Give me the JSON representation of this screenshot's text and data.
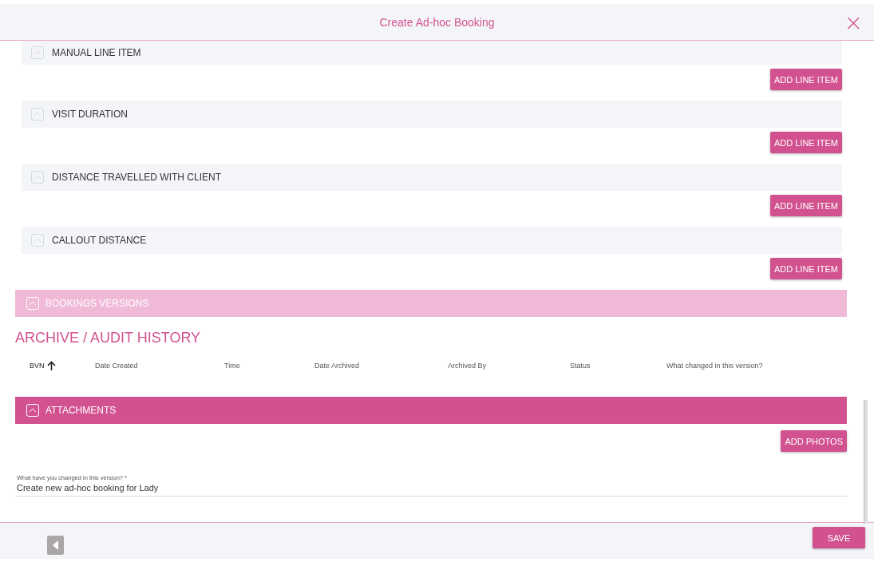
{
  "window": {
    "title": "Create Ad-hoc Booking",
    "close_icon": "×"
  },
  "line_items": [
    {
      "label": "MANUAL LINE ITEM",
      "button": "ADD LINE ITEM"
    },
    {
      "label": "VISIT DURATION",
      "button": "ADD LINE ITEM"
    },
    {
      "label": "DISTANCE TRAVELLED WITH CLIENT",
      "button": "ADD LINE ITEM"
    },
    {
      "label": "CALLOUT DISTANCE",
      "button": "ADD LINE ITEM"
    }
  ],
  "bookings_versions": {
    "label": "BOOKINGS VERSIONS",
    "disabled": true
  },
  "archive": {
    "title": "ARCHIVE / AUDIT HISTORY",
    "columns": [
      {
        "label": "BVN",
        "sorted": true
      },
      {
        "label": "Date Created",
        "sorted": false
      },
      {
        "label": "Time",
        "sorted": false
      },
      {
        "label": "Date Archived",
        "sorted": false
      },
      {
        "label": "Archived By",
        "sorted": false
      },
      {
        "label": "Status",
        "sorted": false
      },
      {
        "label": "What changed in this version?",
        "sorted": false
      }
    ]
  },
  "attachments": {
    "label": "ATTACHMENTS",
    "disabled": false,
    "button": "ADD PHOTOS"
  },
  "change_field": {
    "label": "What have you changed in this version? *",
    "value": "Create new ad-hoc booking for Lady"
  },
  "footer": {
    "button": "SAVE"
  }
}
